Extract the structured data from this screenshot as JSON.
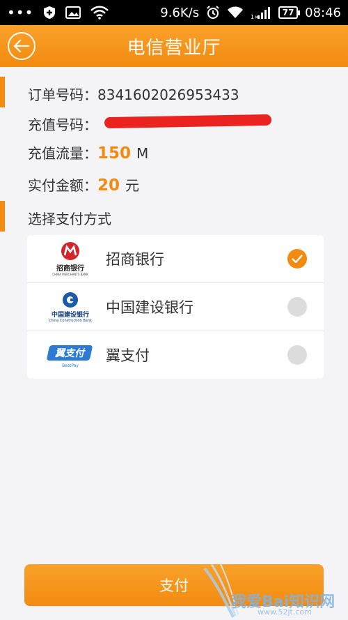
{
  "status_bar": {
    "dots": "•••",
    "net_speed": "9.6K/s",
    "battery": "77",
    "time": "08:46",
    "icons": [
      "shield-icon",
      "image-icon",
      "wifi-icon",
      "alarm-icon",
      "wifi-icon",
      "signal-icon",
      "battery-icon"
    ]
  },
  "header": {
    "title": "电信营业厅",
    "back_icon": "back-arrow-icon"
  },
  "order": {
    "order_no_label": "订单号码：",
    "order_no_value": "8341602026953433",
    "phone_label": "充值号码：",
    "flow_label": "充值流量：",
    "flow_value": "150",
    "flow_unit": "M",
    "amount_label": "实付金额：",
    "amount_value": "20",
    "amount_unit": "元"
  },
  "payment": {
    "section_label": "选择支付方式",
    "methods": [
      {
        "label": "招商银行",
        "logo_text": "招商银行",
        "logo_sub": "CHINA MERCHANTS BANK",
        "selected": true
      },
      {
        "label": "中国建设银行",
        "logo_text": "中国建设银行",
        "logo_sub": "China Construction Bank",
        "selected": false
      },
      {
        "label": "翼支付",
        "logo_text": "翼支付",
        "logo_sub": "BestPay",
        "selected": false
      }
    ]
  },
  "pay_button": "支付",
  "watermark": {
    "text": "我爱Bai知识网",
    "sub": "www.52jt.com"
  },
  "colors": {
    "accent": "#f28b10",
    "redaction": "#ea2220",
    "background": "#f4f4f6"
  }
}
